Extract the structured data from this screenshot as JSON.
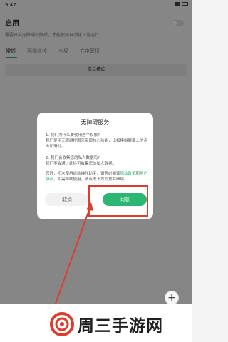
{
  "statusbar": {
    "time": "9:47"
  },
  "header": {
    "title": "启用",
    "subtitle": "需要开启无障碍权限后，才能使用自动化正常运行"
  },
  "tabs": [
    {
      "label": "常规"
    },
    {
      "label": "面部修控"
    },
    {
      "label": "全局"
    },
    {
      "label": "充电警报"
    }
  ],
  "mode_bar": {
    "label": "单点模式"
  },
  "dialog": {
    "title": "无障碍服务",
    "para1": "1. 我们为什么要使用这个权限?\n我们使用无障碍权限来实现核心功能，比如模拟屏幕上的点击和滑动。",
    "para2": "2. 我们会收集您的私人数据吗?\n我们不会通过此许可收集您的私人数据。",
    "para3_a": "您好，初次使用自动操作助手，请务必阅读",
    "para3_link1": "隐私政策",
    "para3_b": "和",
    "para3_link2": "用户协议",
    "para3_c": "，如需继续使用，请点击下方同意并继续。",
    "cancel_label": "取消",
    "agree_label": "同意"
  },
  "fab": {
    "label": "+"
  },
  "watermark": {
    "text": "周三手游网"
  },
  "colors": {
    "accent": "#2bb673",
    "annotation": "#e03b2c"
  }
}
